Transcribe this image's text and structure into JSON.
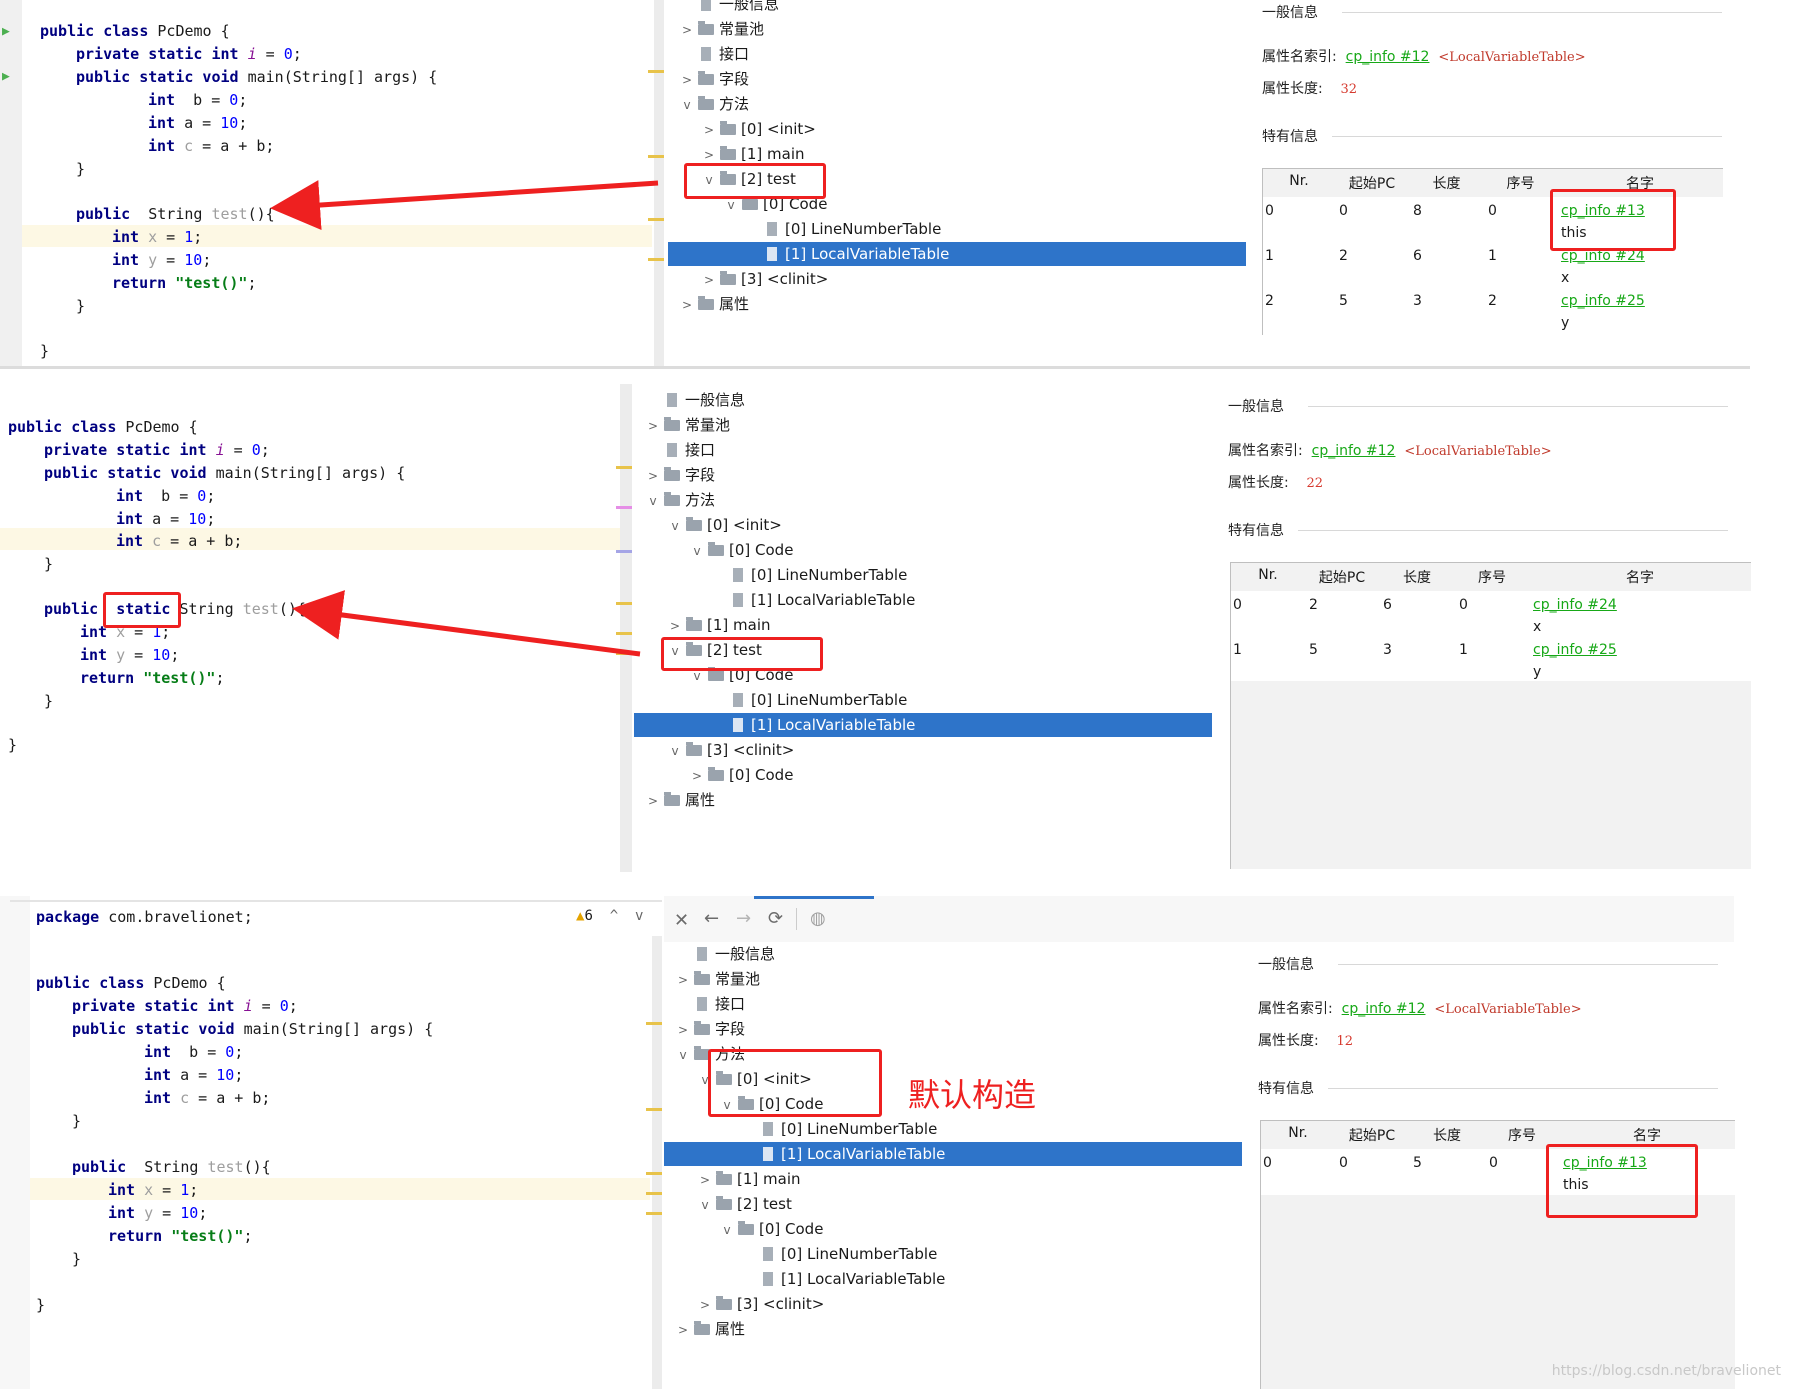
{
  "code": {
    "package_line": "package com.bravelionet;",
    "class_decl": "public class PcDemo {",
    "field_decl": [
      "private static int ",
      "i",
      " = ",
      "0",
      ";"
    ],
    "main_decl": "public static void main(String[] args) {",
    "int_b": [
      "int",
      "b",
      "0"
    ],
    "int_a": [
      "int",
      "a",
      "10"
    ],
    "int_c": [
      "int",
      "c",
      "a + b"
    ],
    "close_brace": "}",
    "test_public": "public",
    "test_static": "static",
    "test_sig": "String test(){",
    "int_x": [
      "int",
      "x",
      "1"
    ],
    "int_y": [
      "int",
      "y",
      "10"
    ],
    "ret": [
      "return",
      "\"test()\""
    ],
    "warnings": "6"
  },
  "tree": {
    "general": "一般信息",
    "constpool": "常量池",
    "interfaces": "接口",
    "fields": "字段",
    "methods": "方法",
    "init": "[0] <init>",
    "main": "[1] main",
    "test": "[2] test",
    "clinit": "[3] <clinit>",
    "code": "[0] Code",
    "lnt": "[0] LineNumberTable",
    "lvt": "[1] LocalVariableTable",
    "attrs": "属性"
  },
  "info": {
    "general_h": "一般信息",
    "name_idx_label": "属性名索引:",
    "name_idx_link": "cp_info #12",
    "name_idx_tag": "<LocalVariableTable>",
    "len_label": "属性长度:",
    "specific_h": "特有信息",
    "cols": [
      "Nr.",
      "起始PC",
      "长度",
      "序号",
      "名字"
    ],
    "panel1": {
      "length": "32",
      "rows": [
        {
          "nr": "0",
          "pc": "0",
          "len": "8",
          "idx": "0",
          "link": "cp_info #13",
          "name": "this"
        },
        {
          "nr": "1",
          "pc": "2",
          "len": "6",
          "idx": "1",
          "link": "cp_info #24",
          "name": "x"
        },
        {
          "nr": "2",
          "pc": "5",
          "len": "3",
          "idx": "2",
          "link": "cp_info #25",
          "name": "y"
        }
      ]
    },
    "panel2": {
      "length": "22",
      "rows": [
        {
          "nr": "0",
          "pc": "2",
          "len": "6",
          "idx": "0",
          "link": "cp_info #24",
          "name": "x"
        },
        {
          "nr": "1",
          "pc": "5",
          "len": "3",
          "idx": "1",
          "link": "cp_info #25",
          "name": "y"
        }
      ]
    },
    "panel3": {
      "length": "12",
      "rows": [
        {
          "nr": "0",
          "pc": "0",
          "len": "5",
          "idx": "0",
          "link": "cp_info #13",
          "name": "this"
        }
      ]
    }
  },
  "annotation": "默认构造",
  "watermark": "https://blog.csdn.net/bravelionet",
  "colors": {
    "accent": "#2e74c9",
    "highlight": "#ee2020",
    "link": "#17a817"
  }
}
